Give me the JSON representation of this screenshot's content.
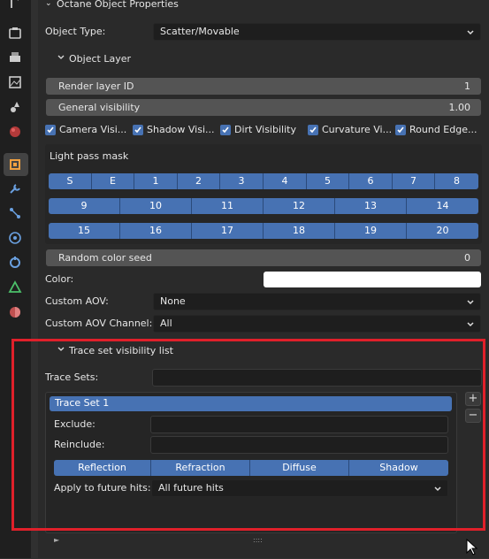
{
  "sidebar": {
    "icons": [
      "wrench-top-icon",
      "output-icon",
      "print-icon",
      "image-icon",
      "shapes-icon",
      "world-icon",
      "object-icon",
      "wrench-icon",
      "particles-icon",
      "physics-icon",
      "constraints-icon",
      "data-icon",
      "material-icon"
    ]
  },
  "section": {
    "title": "Octane Object Properties"
  },
  "object_type": {
    "label": "Object Type:",
    "value": "Scatter/Movable"
  },
  "object_layer": {
    "title": "Object Layer",
    "render_layer": {
      "label": "Render layer ID",
      "value": "1"
    },
    "general_visibility": {
      "label": "General visibility",
      "value": "1.00"
    },
    "checkboxes": [
      {
        "label": "Camera Visi...",
        "checked": true
      },
      {
        "label": "Shadow Visi...",
        "checked": true
      },
      {
        "label": "Dirt Visibility",
        "checked": true
      },
      {
        "label": "Curvature Vi...",
        "checked": true
      },
      {
        "label": "Round Edge...",
        "checked": true
      }
    ],
    "light_pass_mask": {
      "label": "Light pass mask",
      "row1": [
        "S",
        "E",
        "1",
        "2",
        "3",
        "4",
        "5",
        "6",
        "7",
        "8"
      ],
      "row2": [
        "9",
        "10",
        "11",
        "12",
        "13",
        "14"
      ],
      "row3": [
        "15",
        "16",
        "17",
        "18",
        "19",
        "20"
      ]
    },
    "random_color_seed": {
      "label": "Random color seed",
      "value": "0"
    },
    "color": {
      "label": "Color:",
      "value": "#ffffff"
    },
    "custom_aov": {
      "label": "Custom AOV:",
      "value": "None"
    },
    "custom_aov_channel": {
      "label": "Custom AOV Channel:",
      "value": "All"
    }
  },
  "trace": {
    "title": "Trace set visibility list",
    "trace_sets_label": "Trace Sets:",
    "list_item": "Trace Set 1",
    "exclude_label": "Exclude:",
    "reinclude_label": "Reinclude:",
    "tabs": [
      "Reflection",
      "Refraction",
      "Diffuse",
      "Shadow"
    ],
    "apply_label": "Apply to future hits:",
    "apply_value": "All future hits",
    "add_symbol": "+",
    "remove_symbol": "−",
    "grip_symbol": "::::",
    "expand_symbol": "►"
  },
  "colors": {
    "accent": "#4772b3",
    "highlight": "#e0202a"
  }
}
